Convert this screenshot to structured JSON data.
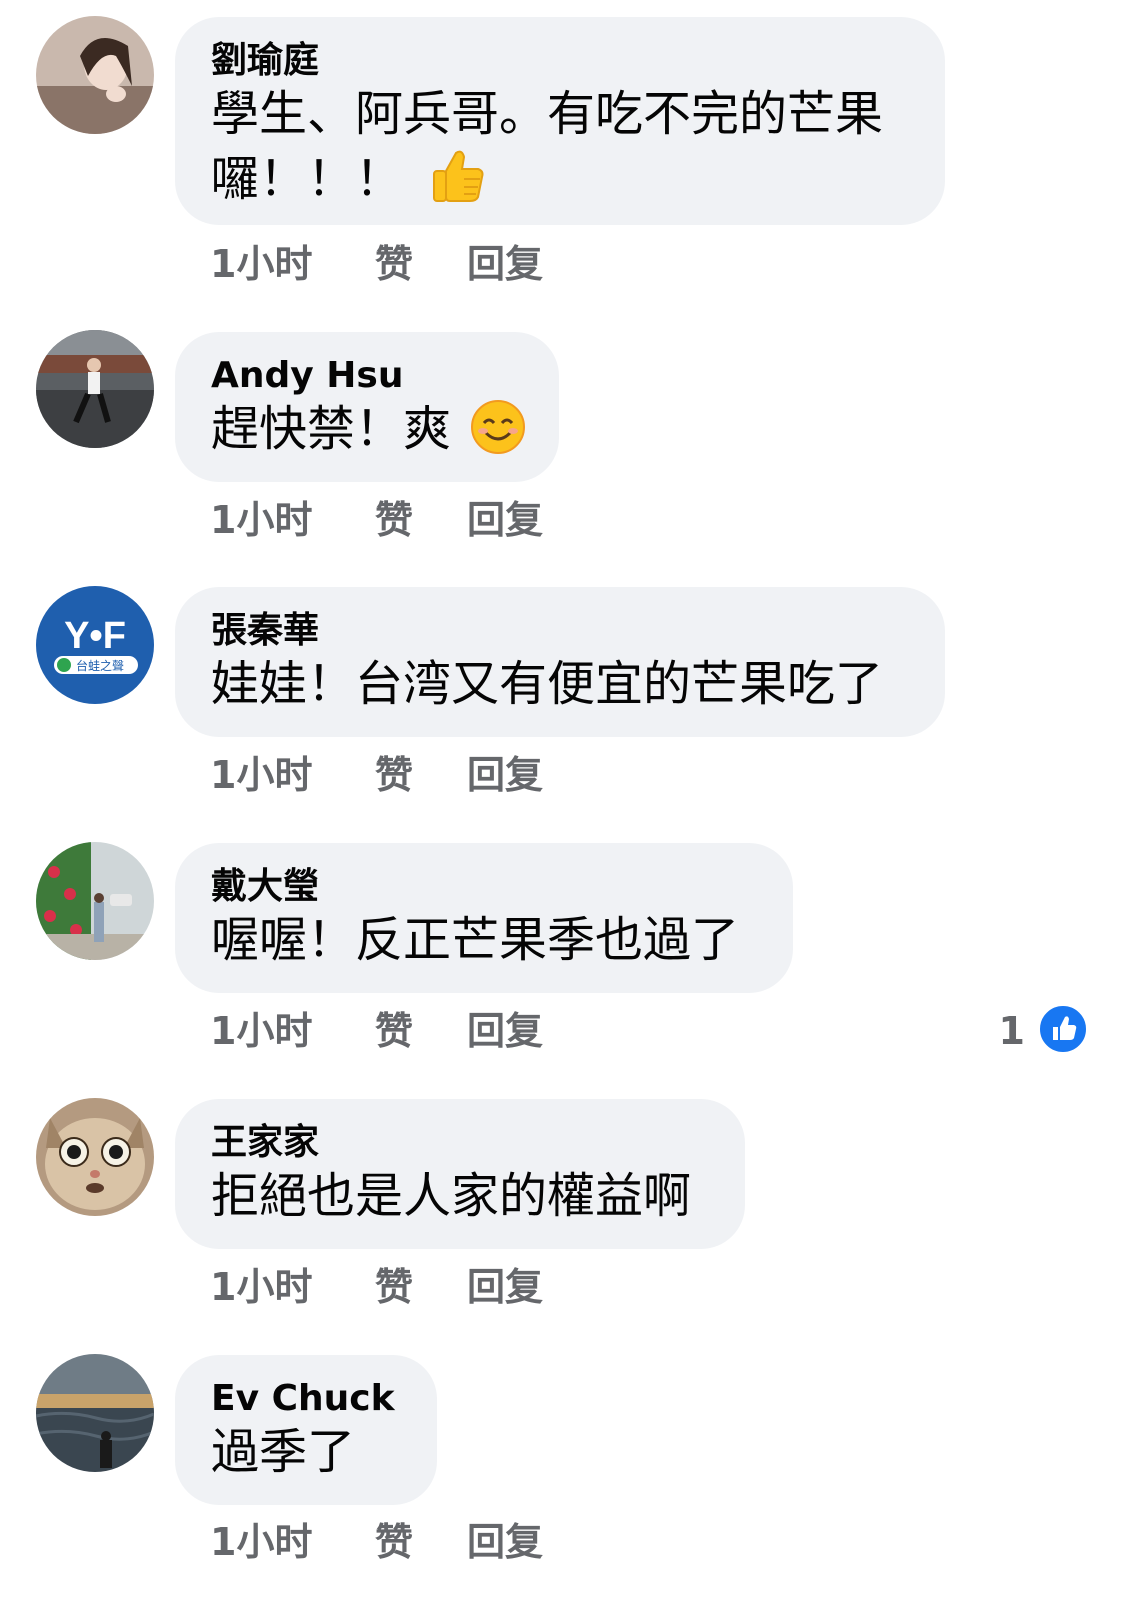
{
  "comments": [
    {
      "author": "劉瑜庭",
      "line1": "學生、阿兵哥。有吃不完的芒果",
      "line2": "囉！！！",
      "emoji": "thumbs-up",
      "time": "1小时",
      "like_label": "赞",
      "reply_label": "回复"
    },
    {
      "author": "Andy Hsu",
      "line1": "趕快禁！爽",
      "emoji": "smiling-face",
      "time": "1小时",
      "like_label": "赞",
      "reply_label": "回复"
    },
    {
      "author": "張秦華",
      "line1": "娃娃！台湾又有便宜的芒果吃了",
      "time": "1小时",
      "like_label": "赞",
      "reply_label": "回复",
      "avatar_text": "Y•F",
      "avatar_subtext": "台蛙之聲"
    },
    {
      "author": "戴大瑩",
      "line1": "喔喔！反正芒果季也過了",
      "time": "1小时",
      "like_label": "赞",
      "reply_label": "回复",
      "reaction_count": "1"
    },
    {
      "author": "王家家",
      "line1": "拒絕也是人家的權益啊",
      "time": "1小时",
      "like_label": "赞",
      "reply_label": "回复"
    },
    {
      "author": "Ev Chuck",
      "line1": "過季了",
      "time": "1小时",
      "like_label": "赞",
      "reply_label": "回复"
    }
  ],
  "colors": {
    "bubble": "#f0f2f5",
    "meta_text": "#65676b",
    "like_blue": "#1877f2"
  }
}
